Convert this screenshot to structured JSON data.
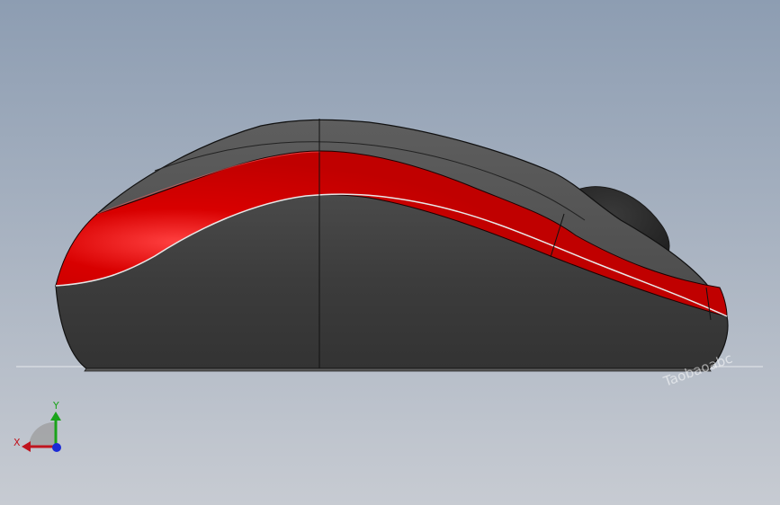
{
  "viewport": {
    "background_top": "#8d9db2",
    "background_bottom": "#c7cbd2"
  },
  "model": {
    "body_color": "#3c3c3c",
    "body_top_color": "#555555",
    "stripe_color": "#d00000",
    "wheel_color": "#2f2f2f",
    "edge_color": "#111111"
  },
  "watermark": {
    "text": "Taobaoabc"
  },
  "triad": {
    "x_label": "X",
    "y_label": "Y",
    "x_color": "#c0141e",
    "y_color": "#1aa31a",
    "z_color": "#1a2ad6"
  }
}
